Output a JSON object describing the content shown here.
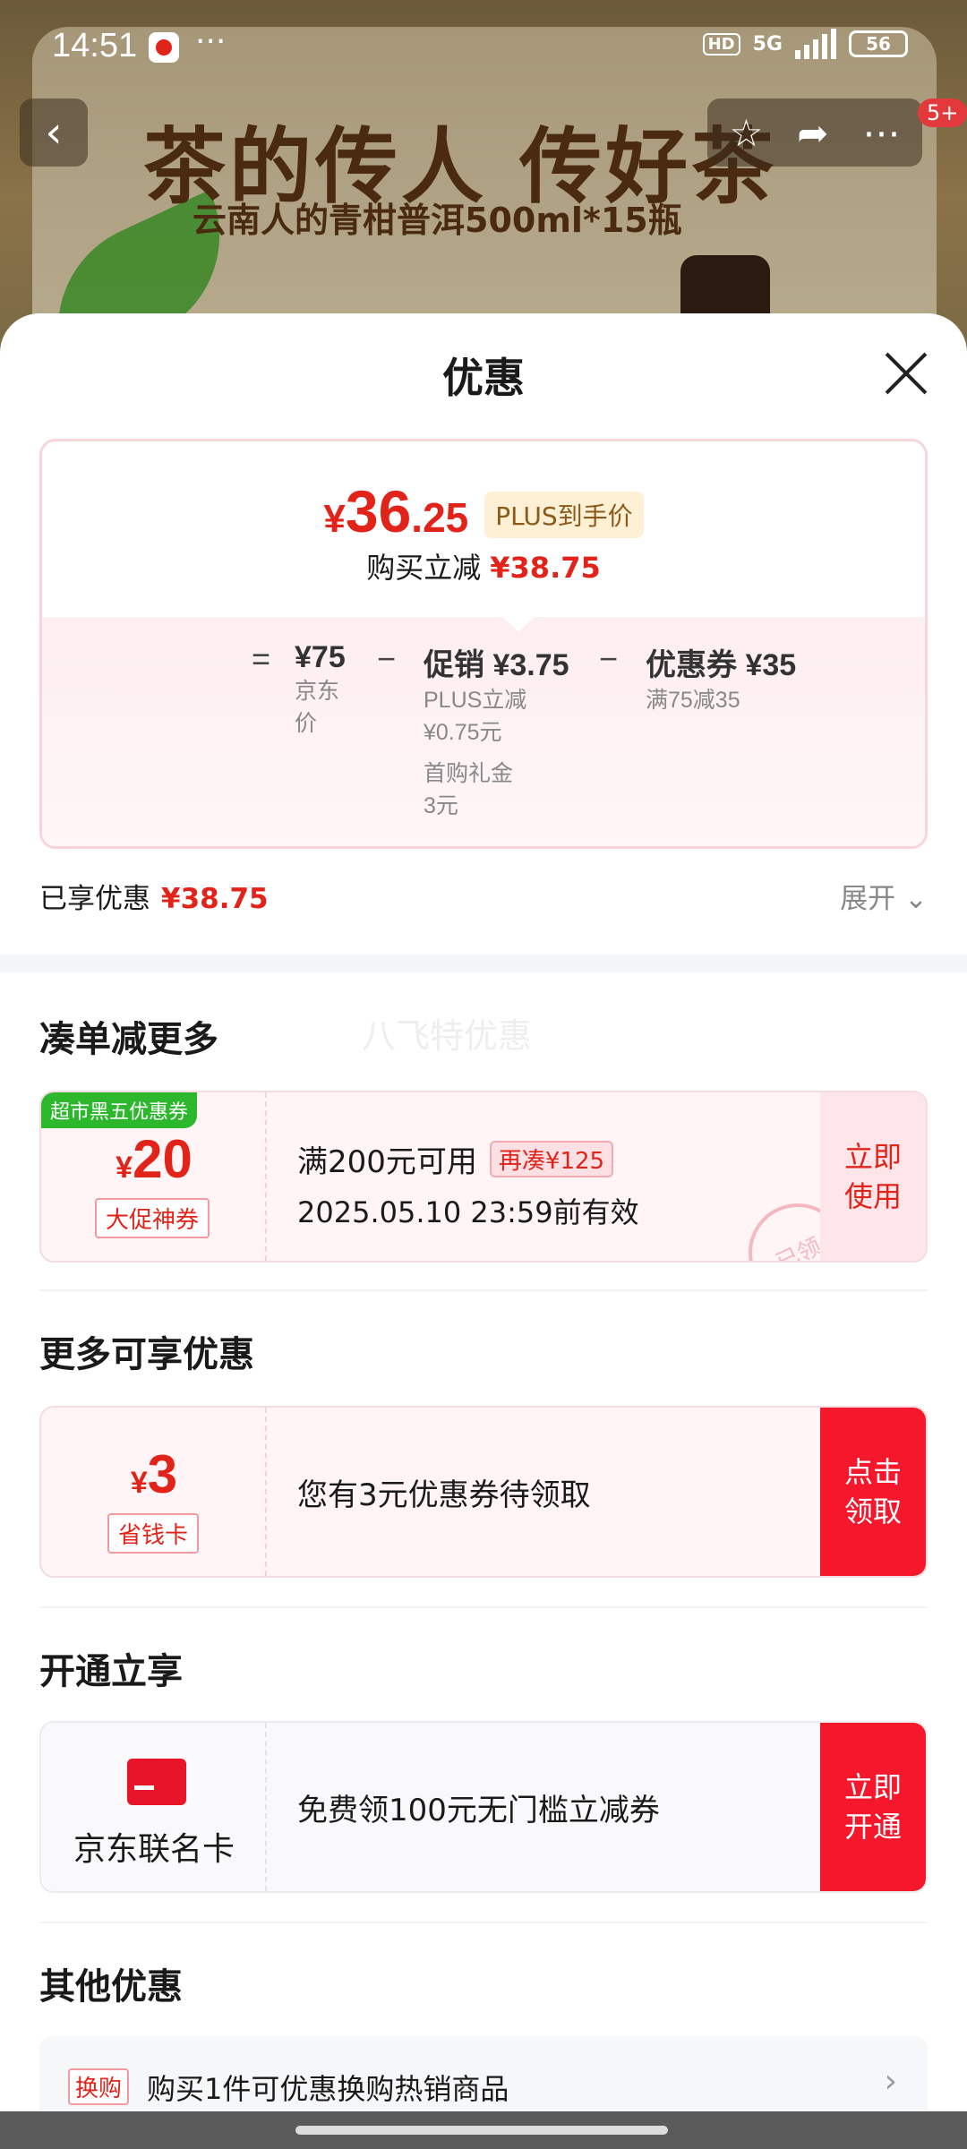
{
  "status_bar": {
    "time": "14:51",
    "dots": "···",
    "hd": "HD",
    "network": "5G",
    "battery": "56"
  },
  "banner": {
    "title": "茶的传人 传好茶",
    "subtitle": "云南人的青柑普洱500ml*15瓶"
  },
  "nav": {
    "back_icon": "‹",
    "notification_badge": "5+"
  },
  "sheet": {
    "title": "优惠",
    "price": {
      "currency": "¥",
      "integer": "36",
      "decimal": ".25",
      "plus_tag": "PLUS到手价"
    },
    "instant_reduce": {
      "label": "购买立减",
      "value": "¥38.75"
    },
    "formula": {
      "eq": "=",
      "minus": "−",
      "jd_price": {
        "main": "¥75",
        "sub1": "京东",
        "sub2": "价"
      },
      "promo": {
        "main": "促销 ¥3.75",
        "sub1": "PLUS立减",
        "sub2": "¥0.75元",
        "sub3": "首购礼金",
        "sub4": "3元"
      },
      "coupon": {
        "main": "优惠券 ¥35",
        "sub1": "满75减35"
      }
    },
    "enjoyed": {
      "label": "已享优惠",
      "value": "¥38.75",
      "expand": "展开"
    }
  },
  "sections": {
    "combine": {
      "title": "凑单减更多",
      "watermark": "八飞特优惠",
      "coupon": {
        "corner": "超市黑五优惠券",
        "currency": "¥",
        "amount": "20",
        "tag": "大促神券",
        "condition": "满200元可用",
        "extra": "再凑¥125",
        "validity": "2025.05.10 23:59前有效",
        "stamp": "已领",
        "action_line1": "立即",
        "action_line2": "使用"
      }
    },
    "more": {
      "title": "更多可享优惠",
      "coupon": {
        "currency": "¥",
        "amount": "3",
        "tag": "省钱卡",
        "text": "您有3元优惠券待领取",
        "action_line1": "点击",
        "action_line2": "领取"
      }
    },
    "open": {
      "title": "开通立享",
      "card": {
        "name": "京东联名卡",
        "text": "免费领100元无门槛立减券",
        "action_line1": "立即",
        "action_line2": "开通"
      }
    },
    "other": {
      "title": "其他优惠",
      "row": {
        "tag": "换购",
        "text": "购买1件可优惠换购热销商品",
        "arrow": "›"
      }
    }
  },
  "colors": {
    "accent_red": "#e2231a",
    "button_red": "#f5172b",
    "plus_gold": "#8a5a1a"
  }
}
